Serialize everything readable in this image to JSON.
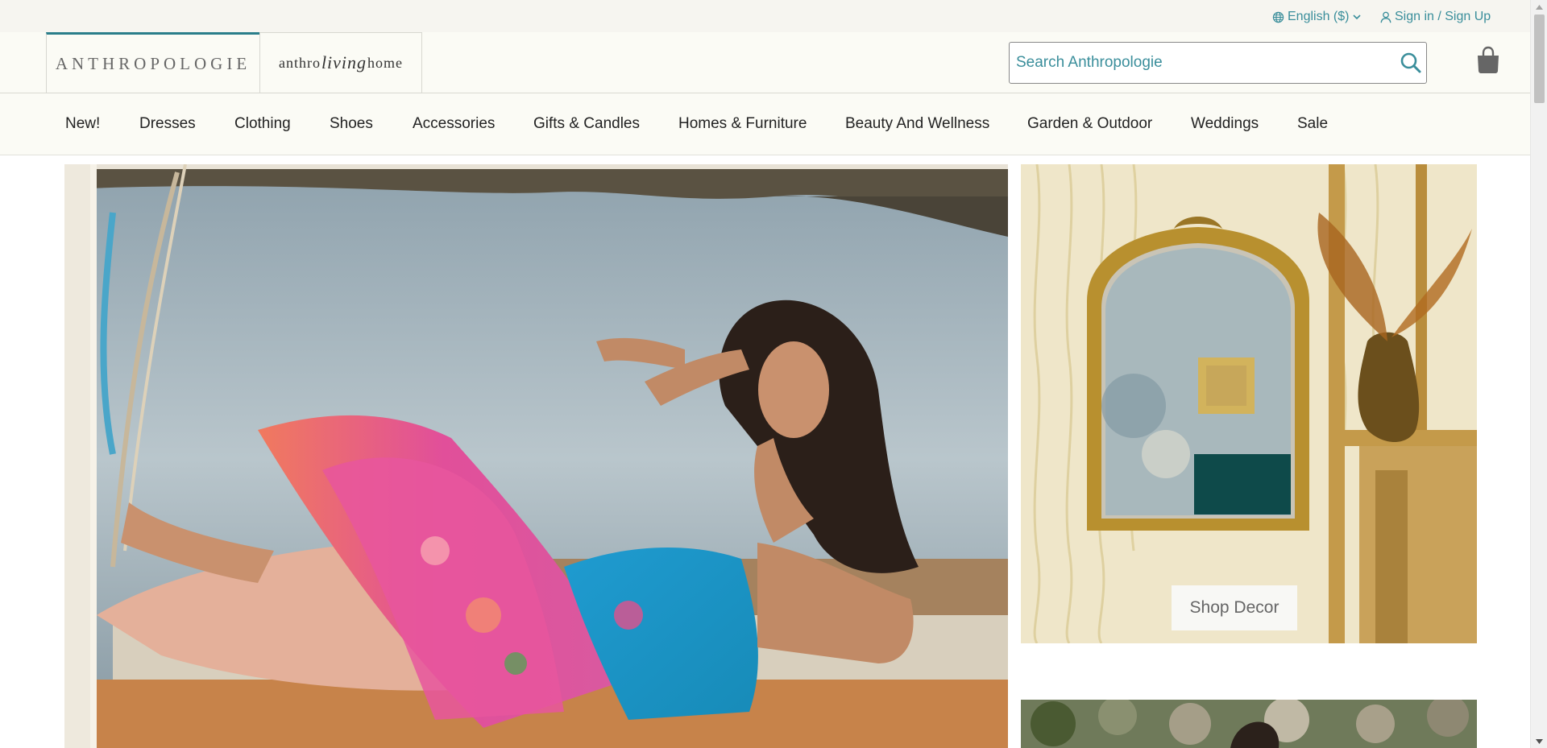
{
  "utility": {
    "language": "English ($)",
    "sign_in": "Sign in / Sign Up"
  },
  "header": {
    "logo_primary": "ANTHROPOLOGIE",
    "logo_secondary_a": "anthro",
    "logo_secondary_b": "living",
    "logo_secondary_c": "home",
    "search_placeholder": "Search Anthropologie"
  },
  "nav": {
    "items": [
      "New!",
      "Dresses",
      "Clothing",
      "Shoes",
      "Accessories",
      "Gifts & Candles",
      "Homes & Furniture",
      "Beauty And Wellness",
      "Garden & Outdoor",
      "Weddings",
      "Sale"
    ]
  },
  "promo": {
    "decor_button": "Shop Decor"
  },
  "colors": {
    "accent": "#3a8e9b",
    "logo_bar": "#2a7e8a",
    "utility_bg": "#f6f5f0",
    "header_bg": "#fbfbf5"
  },
  "icons": [
    "globe-icon",
    "chevron-down-icon",
    "user-icon",
    "search-icon",
    "shopping-bag-icon"
  ]
}
